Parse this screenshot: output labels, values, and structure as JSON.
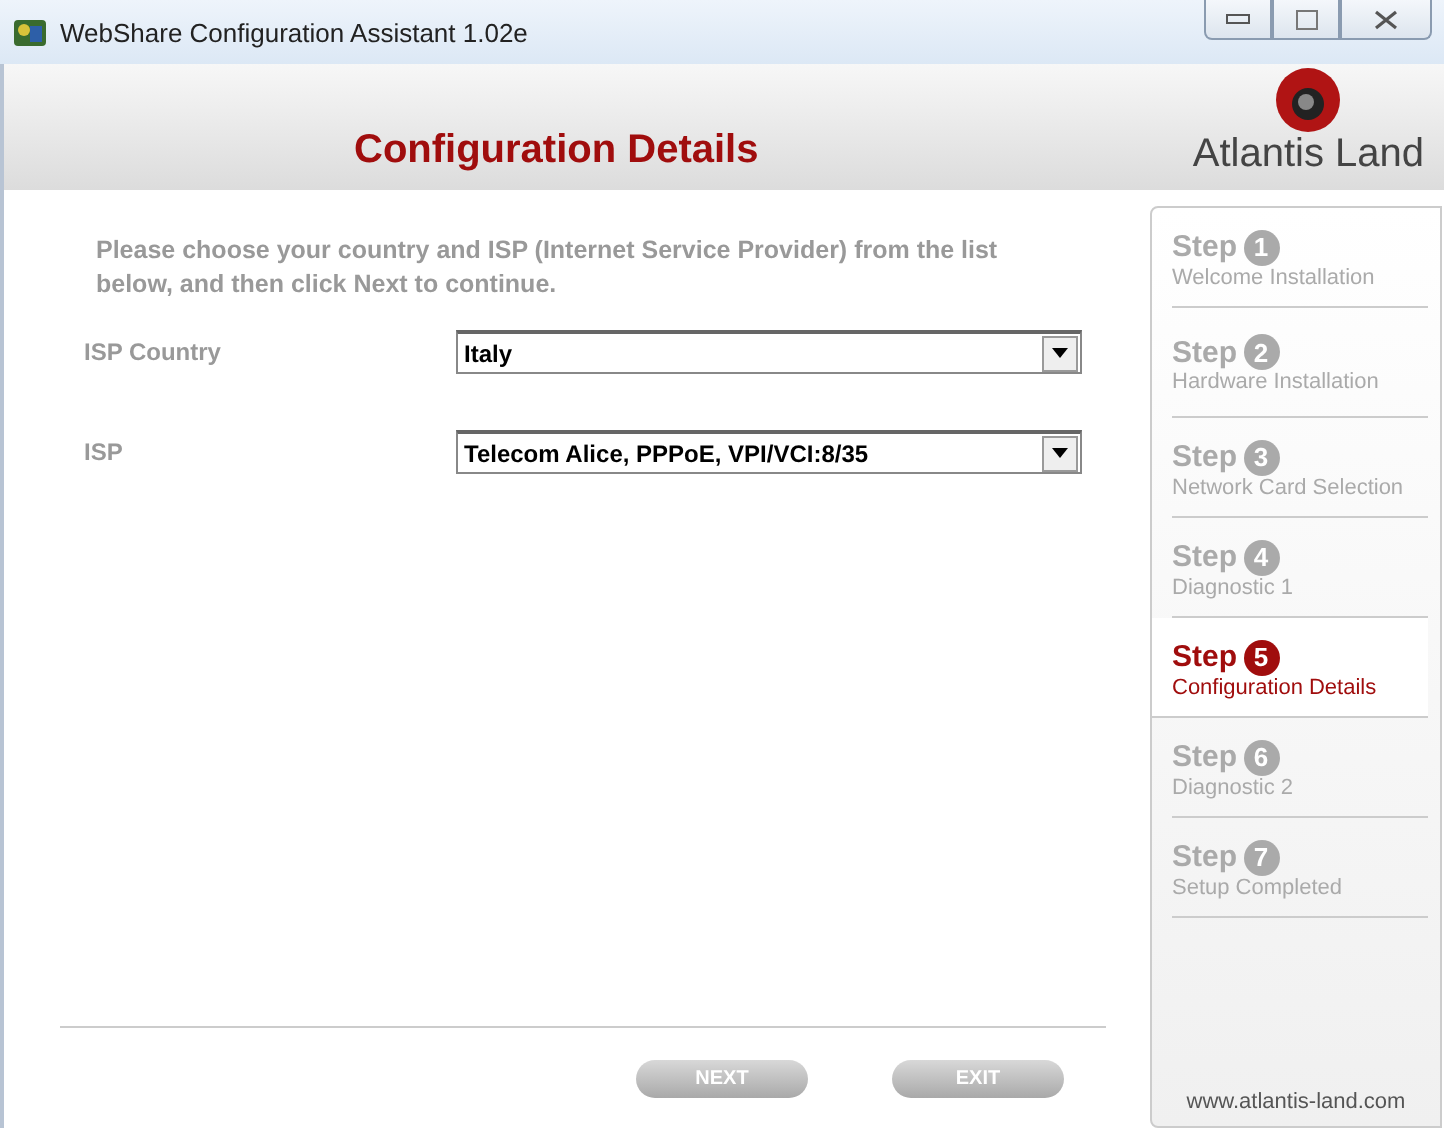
{
  "window": {
    "title": "WebShare Configuration Assistant 1.02e"
  },
  "header": {
    "title": "Configuration Details",
    "logo_text": "Atlantis Land"
  },
  "form": {
    "instructions": "Please choose your country and ISP (Internet Service Provider) from the list below, and then click Next to continue.",
    "fields": [
      {
        "label": "ISP Country",
        "value": "Italy"
      },
      {
        "label": "ISP",
        "value": "Telecom Alice, PPPoE, VPI/VCI:8/35"
      }
    ]
  },
  "buttons": [
    "NEXT",
    "EXIT"
  ],
  "steps": [
    {
      "label": "Step",
      "number": "1",
      "name": "Welcome Installation",
      "selected": false
    },
    {
      "label": "Step",
      "number": "2",
      "name": "Hardware Installation",
      "selected": false
    },
    {
      "label": "Step",
      "number": "3",
      "name": "Network Card Selection",
      "selected": false
    },
    {
      "label": "Step",
      "number": "4",
      "name": "Diagnostic 1",
      "selected": false
    },
    {
      "label": "Step",
      "number": "5",
      "name": "Configuration Details",
      "selected": true
    },
    {
      "label": "Step",
      "number": "6",
      "name": "Diagnostic 2",
      "selected": false
    },
    {
      "label": "Step",
      "number": "7",
      "name": "Setup Completed",
      "selected": false
    }
  ],
  "footer": {
    "url": "www.atlantis-land.com"
  }
}
